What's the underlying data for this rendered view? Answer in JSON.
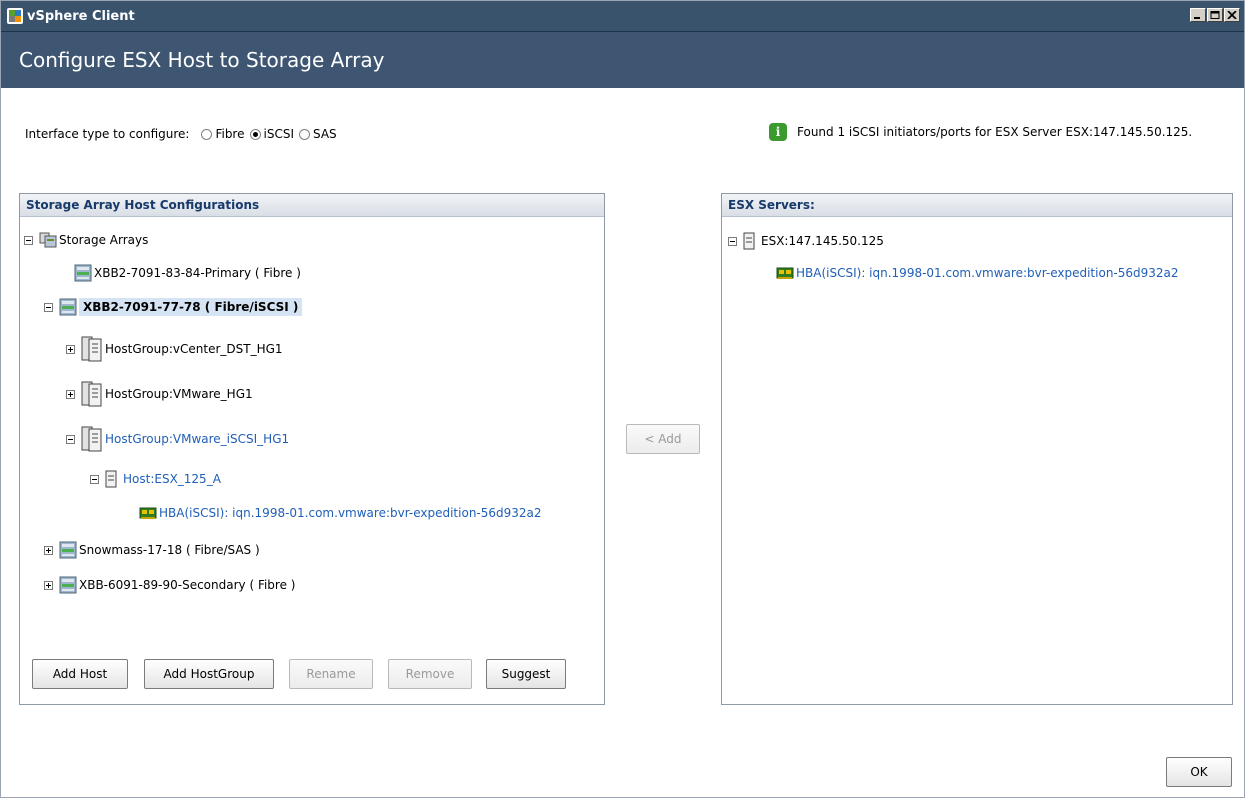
{
  "window": {
    "title": "vSphere Client"
  },
  "header": {
    "title": "Configure ESX Host to Storage Array"
  },
  "interface": {
    "label": "Interface type to configure:",
    "options": [
      {
        "label": "Fibre",
        "selected": false
      },
      {
        "label": "iSCSI",
        "selected": true
      },
      {
        "label": "SAS",
        "selected": false
      }
    ]
  },
  "info_message": "Found 1 iSCSI initiators/ports for ESX Server ESX:147.145.50.125.",
  "left_panel": {
    "title": "Storage Array Host Configurations",
    "tree": {
      "root": "Storage Arrays",
      "array1": "XBB2-7091-83-84-Primary ( Fibre )",
      "array2": "XBB2-7091-77-78 ( Fibre/iSCSI )",
      "hostgroup1": "HostGroup:vCenter_DST_HG1",
      "hostgroup2": "HostGroup:VMware_HG1",
      "hostgroup3": "HostGroup:VMware_iSCSI_HG1",
      "host": "Host:ESX_125_A",
      "hba": "HBA(iSCSI): iqn.1998-01.com.vmware:bvr-expedition-56d932a2",
      "array3": "Snowmass-17-18 ( Fibre/SAS )",
      "array4": "XBB-6091-89-90-Secondary ( Fibre )"
    },
    "buttons": {
      "add_host": "Add Host",
      "add_hostgroup": "Add HostGroup",
      "rename": "Rename",
      "remove": "Remove",
      "suggest": "Suggest"
    }
  },
  "add_button": "< Add",
  "right_panel": {
    "title": "ESX Servers:",
    "tree": {
      "server": "ESX:147.145.50.125",
      "hba": "HBA(iSCSI): iqn.1998-01.com.vmware:bvr-expedition-56d932a2"
    }
  },
  "ok_button": "OK",
  "colors": {
    "header": "#3e5672",
    "link_blue": "#1f5fb8",
    "info_green": "#3a9a2e"
  }
}
